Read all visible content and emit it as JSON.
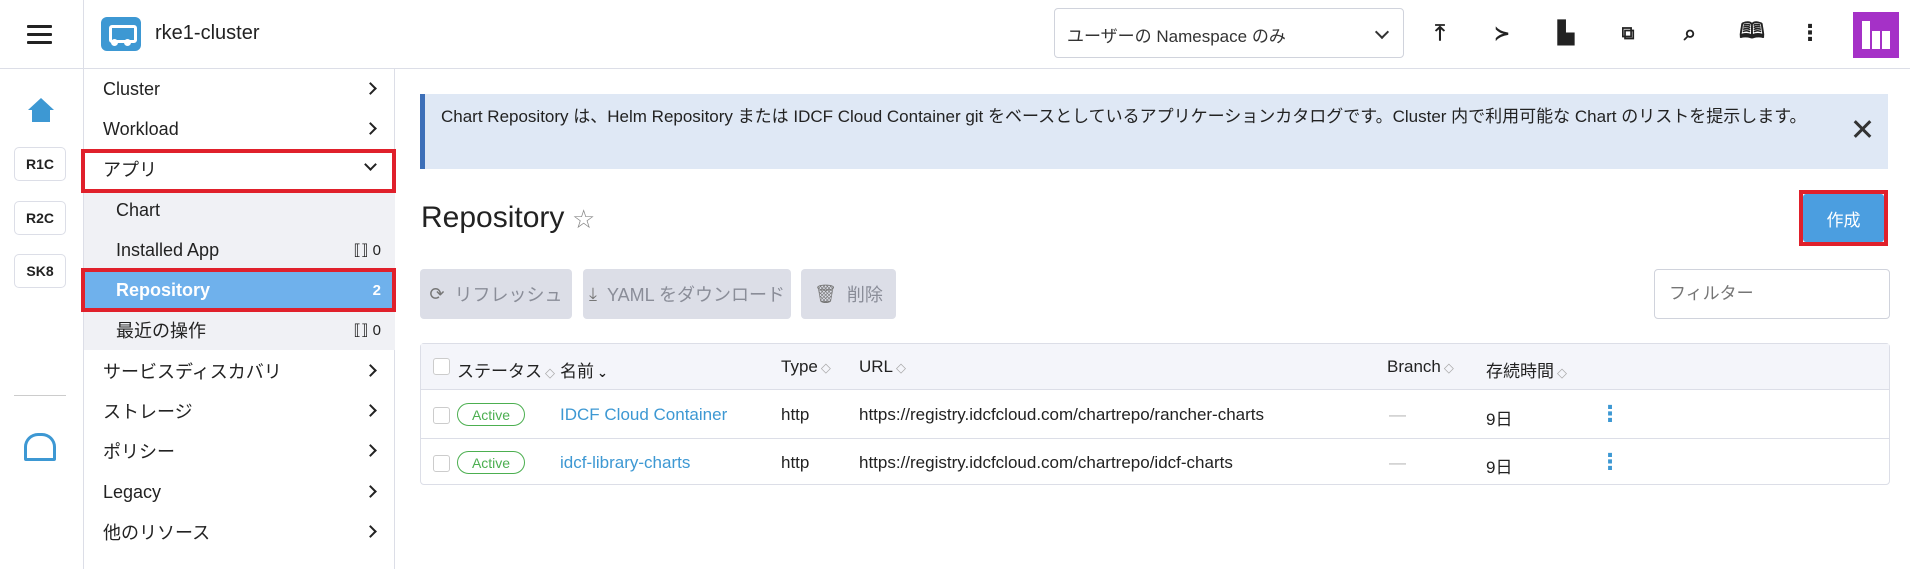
{
  "header": {
    "cluster_name": "rke1-cluster",
    "namespace_select": "ユーザーの Namespace のみ",
    "icons": [
      "upload-icon",
      "terminal-icon",
      "file-icon",
      "copy-config-icon",
      "search-icon",
      "book-icon",
      "more-vertical-icon"
    ]
  },
  "rail": {
    "chips": [
      "R1C",
      "R2C",
      "SK8"
    ]
  },
  "sidenav": {
    "items": [
      {
        "label": "Cluster"
      },
      {
        "label": "Workload"
      },
      {
        "label": "アプリ"
      },
      {
        "label": "サービスディスカバリ"
      },
      {
        "label": "ストレージ"
      },
      {
        "label": "ポリシー"
      },
      {
        "label": "Legacy"
      },
      {
        "label": "他のリソース"
      }
    ],
    "sub_items": [
      {
        "label": "Chart",
        "count": ""
      },
      {
        "label": "Installed App",
        "count": "0"
      },
      {
        "label": "Repository",
        "count": "2"
      },
      {
        "label": "最近の操作",
        "count": "0"
      }
    ]
  },
  "main": {
    "banner": "Chart Repository は、Helm Repository または IDCF Cloud Container git をベースとしているアプリケーションカタログです。Cluster 内で利用可能な Chart のリストを提示します。",
    "title": "Repository",
    "create_label": "作成",
    "buttons": {
      "refresh": "リフレッシュ",
      "download": "YAML をダウンロード",
      "delete": "削除"
    },
    "filter_placeholder": "フィルター",
    "table": {
      "columns": [
        "ステータス",
        "名前",
        "Type",
        "URL",
        "Branch",
        "存続時間"
      ],
      "rows": [
        {
          "status": "Active",
          "name": "IDCF Cloud Container",
          "type": "http",
          "url": "https://registry.idcfcloud.com/chartrepo/rancher-charts",
          "branch": "—",
          "age": "9日"
        },
        {
          "status": "Active",
          "name": "idcf-library-charts",
          "type": "http",
          "url": "https://registry.idcfcloud.com/chartrepo/idcf-charts",
          "branch": "—",
          "age": "9日"
        }
      ]
    }
  },
  "colors": {
    "accent": "#3d98d3",
    "active_nav": "#6fb1ec",
    "highlight_border": "#e0202b",
    "status_active": "#4caf50"
  }
}
